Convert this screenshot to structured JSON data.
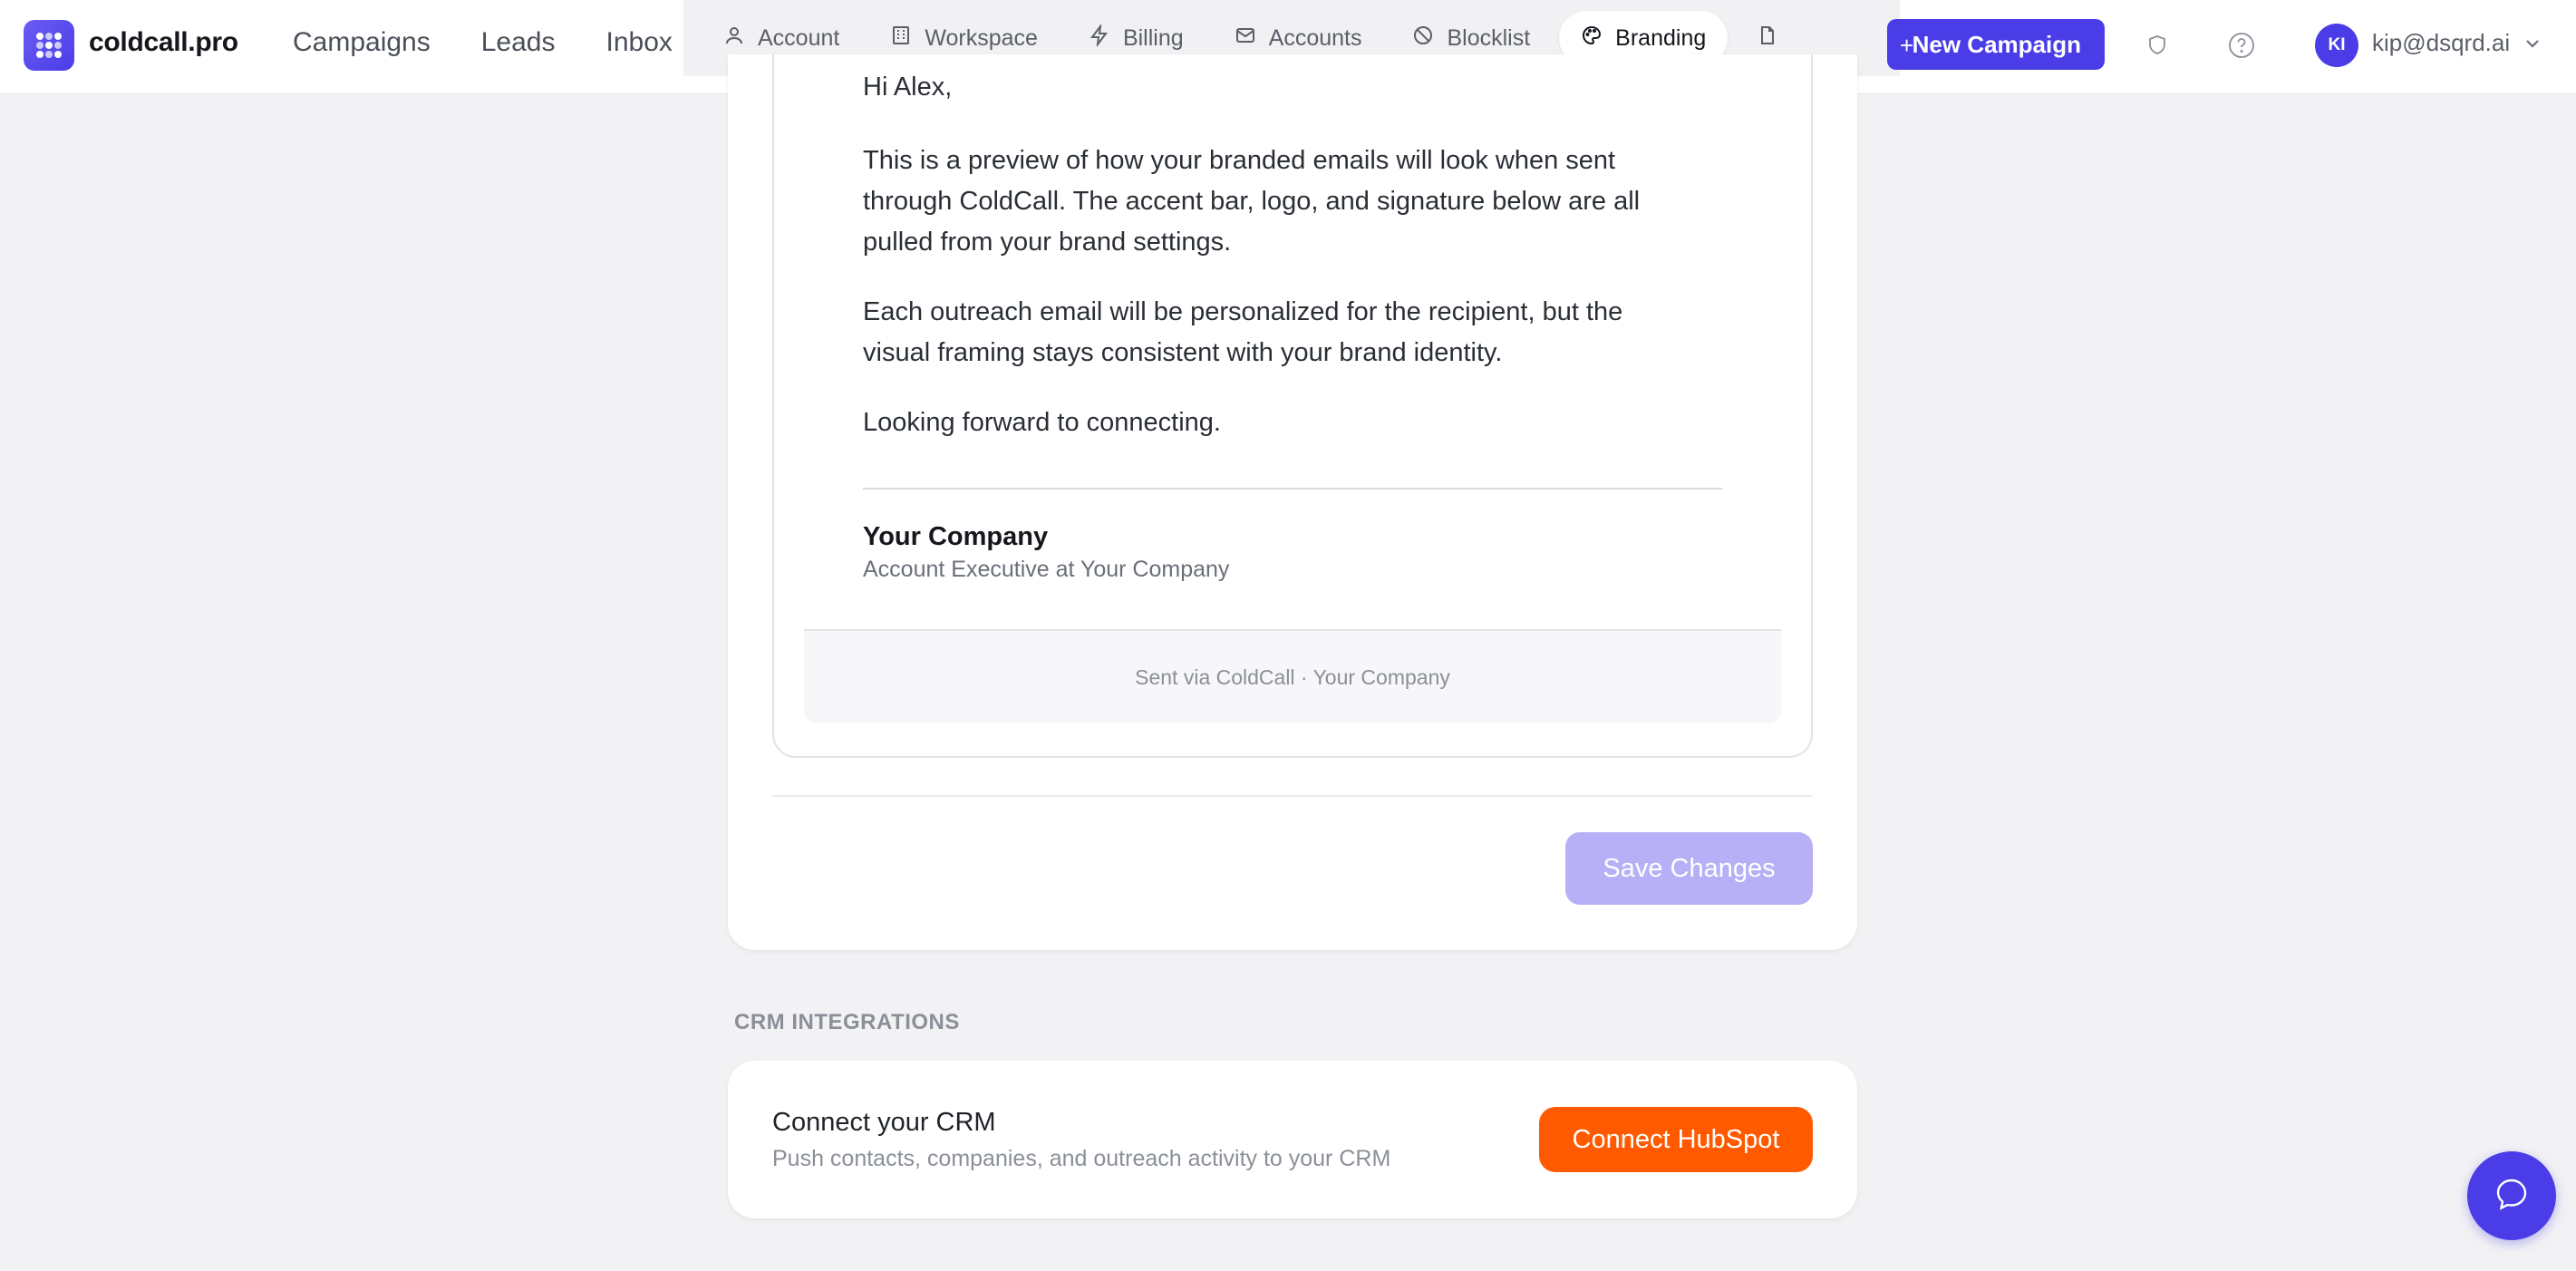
{
  "app": {
    "brand_name": "coldcall.pro",
    "logo_icon": "grid-dots-logo",
    "accent_color": "#4a3de8"
  },
  "nav": {
    "items": [
      {
        "label": "Campaigns"
      },
      {
        "label": "Leads"
      },
      {
        "label": "Inbox"
      }
    ]
  },
  "settings_tabs": {
    "tabs": [
      {
        "label": "Account",
        "icon": "user-icon"
      },
      {
        "label": "Workspace",
        "icon": "building-icon"
      },
      {
        "label": "Billing",
        "icon": "bolt-icon"
      },
      {
        "label": "Accounts",
        "icon": "mail-icon"
      },
      {
        "label": "Blocklist",
        "icon": "ban-icon"
      },
      {
        "label": "Branding",
        "icon": "palette-icon",
        "active": true
      }
    ],
    "overflow_icon": "document-icon"
  },
  "header": {
    "new_campaign_label": "New Campaign",
    "new_campaign_icon": "+",
    "avatar_initials": "KI",
    "user_email": "kip@dsqrd.ai"
  },
  "email_preview": {
    "greeting": "Hi Alex,",
    "paragraphs": [
      "This is a preview of how your branded emails will look when sent through ColdCall. The accent bar, logo, and signature below are all pulled from your brand settings.",
      "Each outreach email will be personalized for the recipient, but the visual framing stays consistent with your brand identity.",
      "Looking forward to connecting."
    ],
    "signature_name": "Your Company",
    "signature_title": "Account Executive at Your Company",
    "footer_text": "Sent via ColdCall · Your Company"
  },
  "actions": {
    "save_label": "Save Changes",
    "save_color": "#b7b0f6"
  },
  "crm": {
    "section_heading": "CRM INTEGRATIONS",
    "title": "Connect your CRM",
    "description": "Push contacts, companies, and outreach activity to your CRM",
    "button_label": "Connect HubSpot",
    "button_color": "#ff5a00"
  }
}
